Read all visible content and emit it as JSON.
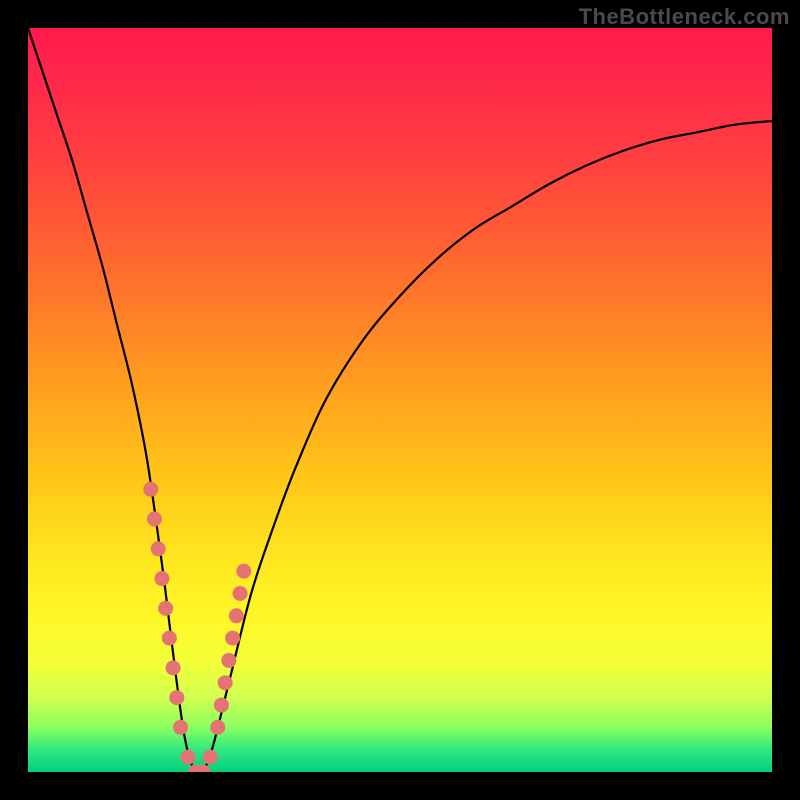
{
  "brand": "TheBottleneck.com",
  "chart_data": {
    "type": "line",
    "title": "",
    "xlabel": "",
    "ylabel": "",
    "xlim": [
      0,
      100
    ],
    "ylim": [
      0,
      100
    ],
    "grid": false,
    "series": [
      {
        "name": "bottleneck-curve",
        "x": [
          0,
          2,
          4,
          6,
          8,
          10,
          12,
          14,
          16,
          18,
          19,
          20,
          21,
          22,
          23,
          24,
          25,
          27,
          30,
          33,
          36,
          40,
          45,
          50,
          55,
          60,
          65,
          70,
          75,
          80,
          85,
          90,
          95,
          100
        ],
        "values": [
          100,
          94,
          88,
          82,
          75,
          68,
          60,
          52,
          42,
          28,
          20,
          12,
          5,
          1,
          0,
          1,
          4,
          12,
          24,
          33,
          41,
          50,
          58,
          64,
          69,
          73,
          76,
          79,
          81.5,
          83.5,
          85,
          86,
          87,
          87.5
        ]
      }
    ],
    "markers": {
      "name": "highlighted-points",
      "color": "#e57373",
      "x": [
        16.5,
        17.0,
        17.5,
        18.0,
        18.5,
        19.0,
        19.5,
        20.0,
        20.5,
        21.5,
        22.5,
        23.5,
        24.5,
        25.5,
        26.0,
        26.5,
        27.0,
        27.5,
        28.0,
        28.5,
        29.0
      ],
      "values": [
        38,
        34,
        30,
        26,
        22,
        18,
        14,
        10,
        6,
        2,
        0,
        0,
        2,
        6,
        9,
        12,
        15,
        18,
        21,
        24,
        27
      ]
    }
  }
}
